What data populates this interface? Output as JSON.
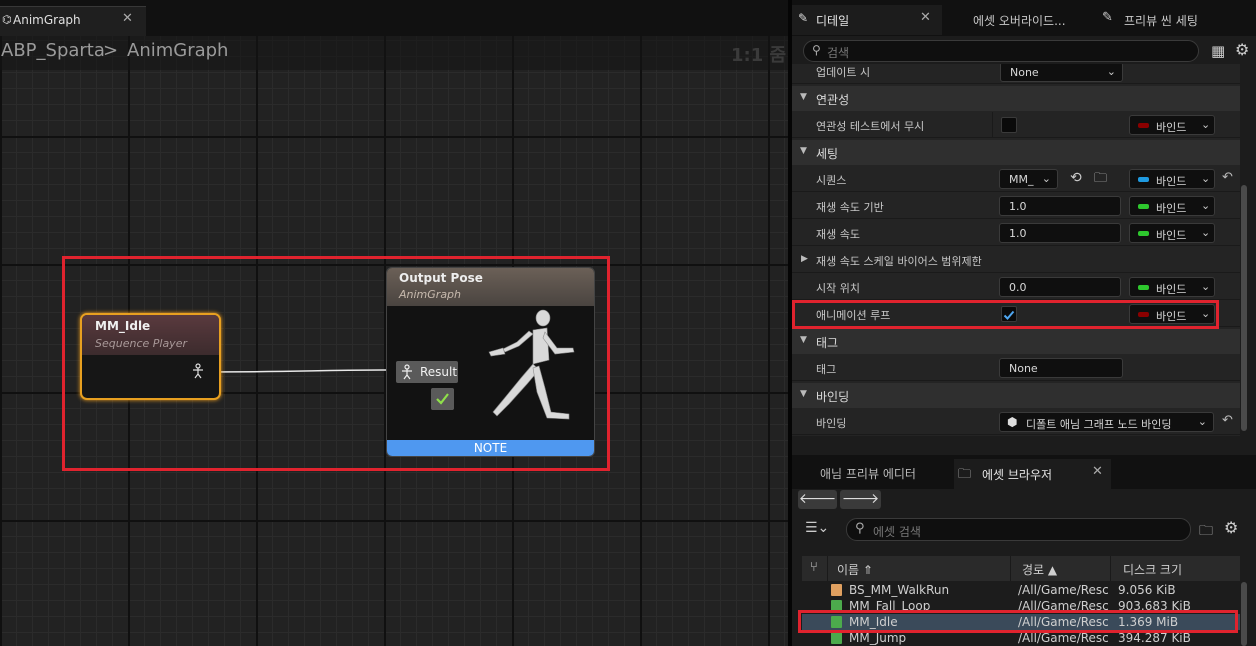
{
  "graph": {
    "tab_label": "AnimGraph",
    "breadcrumb": {
      "root": "ABP_Sparta",
      "separator": ">",
      "current": "AnimGraph"
    },
    "zoom_label": "1:1 줌",
    "nodes": {
      "sequence": {
        "title": "MM_Idle",
        "subtitle": "Sequence Player"
      },
      "output": {
        "title": "Output Pose",
        "subtitle": "AnimGraph",
        "pin_label": "Result",
        "note": "NOTE"
      }
    }
  },
  "details": {
    "tabs": {
      "details": "디테일",
      "asset_override": "에셋 오버라이드...",
      "preview_scene": "프리뷰 씬 세팅"
    },
    "search_placeholder": "검색",
    "partial_row": {
      "name": "업데이트 시",
      "value": "None"
    },
    "categories": {
      "relevancy": "연관성",
      "settings": "세팅",
      "tag": "태그",
      "binding": "바인딩"
    },
    "rows": {
      "relevancy_ignore": {
        "name": "연관성 테스트에서 무시",
        "bind": "바인드"
      },
      "sequence": {
        "name": "시퀀스",
        "value": "MM_",
        "bind": "바인드"
      },
      "play_rate_basis": {
        "name": "재생 속도 기반",
        "value": "1.0",
        "bind": "바인드"
      },
      "play_rate": {
        "name": "재생 속도",
        "value": "1.0",
        "bind": "바인드"
      },
      "play_rate_scale": {
        "name": "재생 속도 스케일 바이어스 범위제한"
      },
      "start_position": {
        "name": "시작 위치",
        "value": "0.0",
        "bind": "바인드"
      },
      "loop_animation": {
        "name": "애니메이션 루프",
        "checked": true,
        "bind": "바인드"
      },
      "tag": {
        "name": "태그",
        "value": "None"
      },
      "binding": {
        "name": "바인딩",
        "value": "디폴트 애님 그래프 노드 바인딩"
      }
    },
    "bind_colors": {
      "red": "#8b0000",
      "blue": "#1f9ae0",
      "green": "#2ec82e"
    }
  },
  "asset_browser": {
    "tabs": {
      "anim_preview": "애님 프리뷰 에디터",
      "content": "에셋 브라우저"
    },
    "search_placeholder": "에셋 검색",
    "columns": {
      "name": "이름",
      "path": "경로",
      "size": "디스크 크기"
    },
    "rows": [
      {
        "name": "BS_MM_WalkRun",
        "path": "/All/Game/Resc",
        "size": "9.056 KiB",
        "icon_color": "#e0a060"
      },
      {
        "name": "MM_Fall_Loop",
        "path": "/All/Game/Resc",
        "size": "903.683 KiB",
        "icon_color": "#4caa4c"
      },
      {
        "name": "MM_Idle",
        "path": "/All/Game/Resc",
        "size": "1.369 MiB",
        "icon_color": "#4caa4c"
      },
      {
        "name": "MM_Jump",
        "path": "/All/Game/Resc",
        "size": "394.287 KiB",
        "icon_color": "#4caa4c"
      }
    ]
  }
}
